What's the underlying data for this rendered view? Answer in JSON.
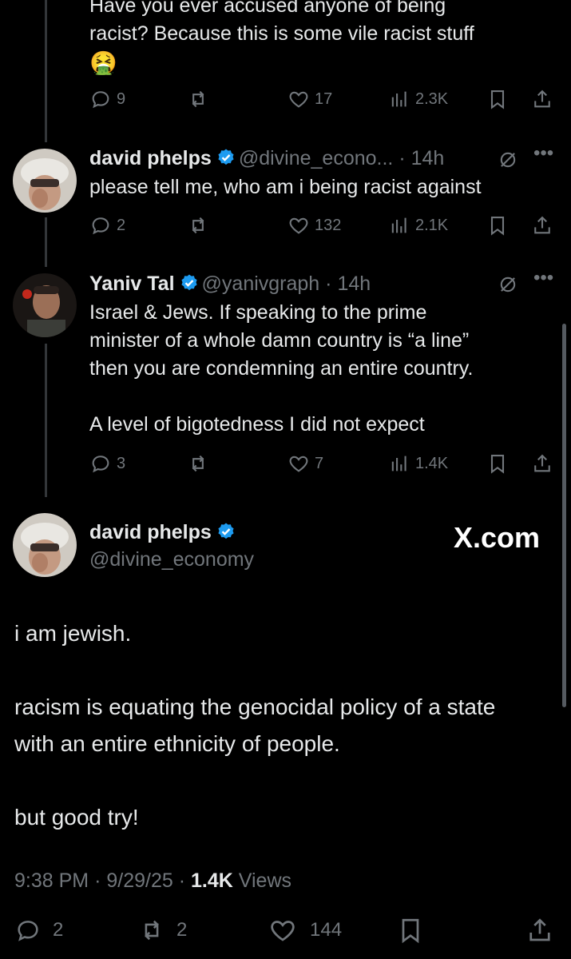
{
  "tweet0": {
    "text_line1": "Have you ever accused anyone of being",
    "text_line2": "racist? Because this is some vile racist stuff",
    "emoji": "🤮",
    "replies": "9",
    "likes": "17",
    "views": "2.3K"
  },
  "tweet1": {
    "name": "david phelps",
    "handle": "@divine_econo...",
    "dot": "·",
    "time": "14h",
    "text": "please tell me, who am i being racist against",
    "replies": "2",
    "likes": "132",
    "views": "2.1K"
  },
  "tweet2": {
    "name": "Yaniv Tal",
    "handle": "@yanivgraph",
    "dot": "·",
    "time": "14h",
    "text_line1": "Israel & Jews. If speaking to the prime",
    "text_line2": "minister of a whole damn country is “a line”",
    "text_line3": "then you are condemning an entire country.",
    "text_line4": "A level of bigotedness I did not expect",
    "replies": "3",
    "likes": "7",
    "views": "1.4K"
  },
  "main": {
    "name": "david phelps",
    "handle": "@divine_economy",
    "watermark": "X.com",
    "para1": "i am jewish.",
    "para2_line1": "racism is equating the genocidal policy of a state",
    "para2_line2": "with an entire ethnicity of people.",
    "para3": "but good try!",
    "time": "9:38 PM",
    "sep1": "·",
    "date": "9/29/25",
    "sep2": "·",
    "views_count": "1.4K",
    "views_label": "Views",
    "replies": "2",
    "reposts": "2",
    "likes": "144"
  },
  "colors": {
    "background": "#000000",
    "text": "#e7e9ea",
    "muted": "#71767b",
    "verified": "#1d9bf0"
  }
}
